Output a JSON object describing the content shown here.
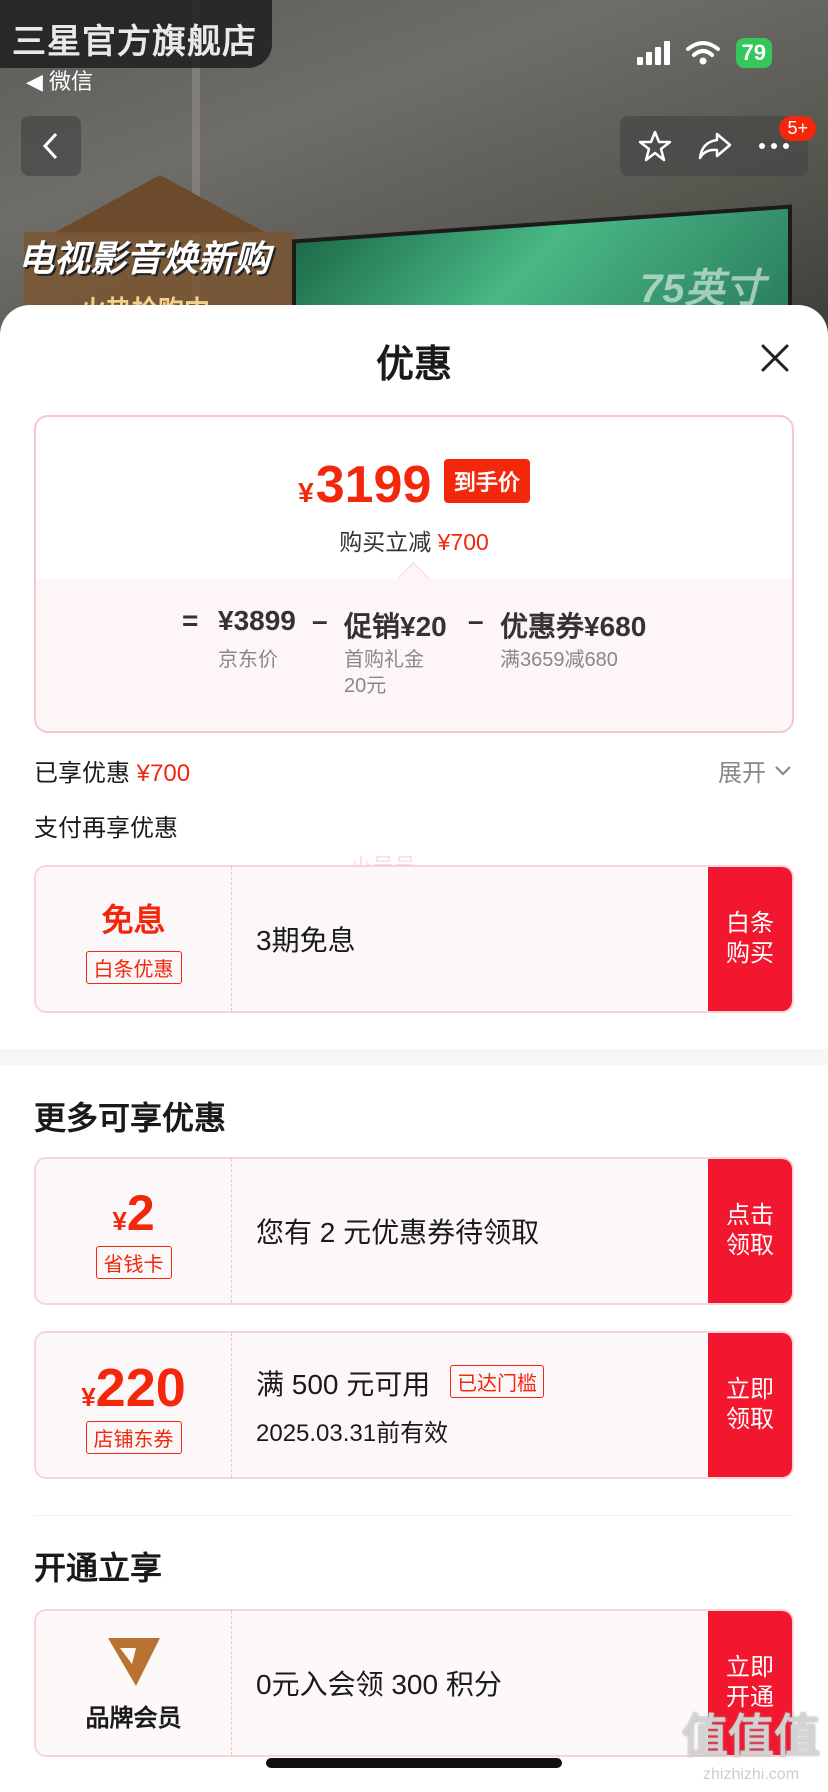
{
  "background": {
    "store_name": "三星官方旗舰店",
    "back_app": "◀ 微信",
    "banner": "电视影音焕新购",
    "banner_sub": "火热抢购中",
    "tv_size": "75英寸",
    "battery": "79",
    "nav_badge": "5+"
  },
  "sheet": {
    "title": "优惠"
  },
  "price_card": {
    "currency": "¥",
    "final_price": "3199",
    "final_badge": "到手价",
    "reduce_label": "购买立减",
    "reduce_value": "¥700",
    "equals": "=",
    "base_price": "¥3899",
    "base_label": "京东价",
    "minus1": "–",
    "promo": "促销¥20",
    "promo_label": "首购礼金\n20元",
    "minus2": "–",
    "coupon": "优惠券¥680",
    "coupon_label": "满3659减680"
  },
  "enjoyed": {
    "label": "已享优惠",
    "value": "¥700",
    "expand": "展开"
  },
  "pay_more": {
    "title": "支付再享优惠",
    "watermark": "小号号",
    "offer": {
      "left_main": "免息",
      "left_tag": "白条优惠",
      "mid": "3期免息",
      "button": "白条购买"
    }
  },
  "more_offers": {
    "title": "更多可享优惠",
    "items": [
      {
        "currency": "¥",
        "amount": "2",
        "tag": "省钱卡",
        "mid": "您有 2 元优惠券待领取",
        "button": "点击领取"
      },
      {
        "currency": "¥",
        "amount": "220",
        "tag": "店铺东券",
        "mid": "满 500 元可用",
        "threshold": "已达门槛",
        "sub": "2025.03.31前有效",
        "button": "立即领取"
      }
    ]
  },
  "open_enjoy": {
    "title": "开通立享",
    "item": {
      "label": "品牌会员",
      "mid": "0元入会领 300 积分",
      "button": "立即开通"
    }
  },
  "site_mark": {
    "big": "值值值",
    "small": "zhizhizhi.com"
  },
  "colors": {
    "accent": "#f2270c",
    "button": "#f2162e",
    "card_border": "#f8d4d8",
    "card_bg": "#fcf7f8"
  }
}
